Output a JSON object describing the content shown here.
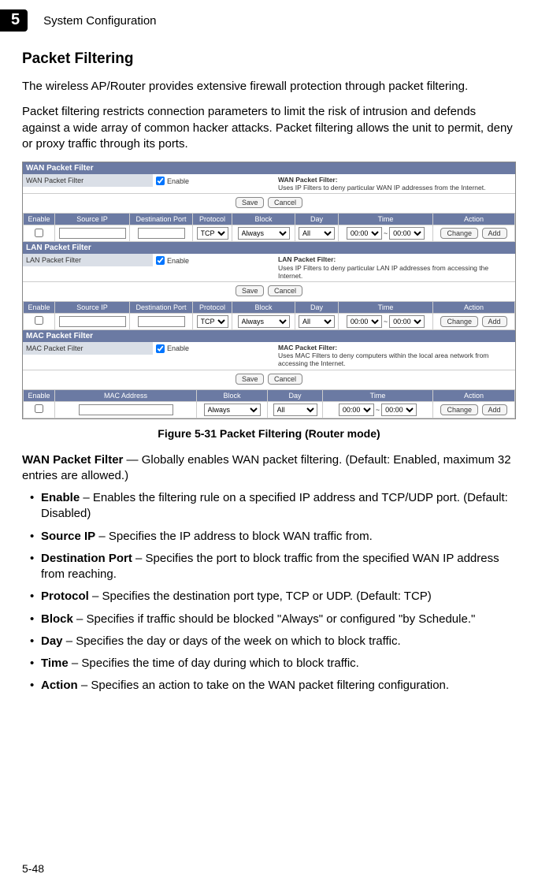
{
  "header": {
    "chapter_num": "5",
    "chapter_title": "System Configuration"
  },
  "section": {
    "title": "Packet Filtering",
    "p1": "The wireless AP/Router provides extensive firewall protection through packet filtering.",
    "p2": "Packet filtering restricts connection parameters to limit the risk of intrusion and defends against a wide array of common hacker attacks. Packet filtering allows the unit to permit, deny or proxy traffic through its ports."
  },
  "screenshot": {
    "enable_label": "Enable",
    "save_btn": "Save",
    "cancel_btn": "Cancel",
    "change_btn": "Change",
    "add_btn": "Add",
    "sections": {
      "wan": {
        "hdr": "WAN Packet Filter",
        "row_label": "WAN Packet Filter",
        "desc_title": "WAN Packet Filter:",
        "desc_body": "Uses IP Filters to deny particular WAN IP addresses from the Internet."
      },
      "lan": {
        "hdr": "LAN Packet Filter",
        "row_label": "LAN Packet Filter",
        "desc_title": "LAN Packet Filter:",
        "desc_body": "Uses IP Filters to deny particular LAN IP addresses from accessing the Internet."
      },
      "mac": {
        "hdr": "MAC Packet Filter",
        "row_label": "MAC Packet Filter",
        "desc_title": "MAC Packet Filter:",
        "desc_body": "Uses MAC Filters to deny computers within the local area network from accessing the Internet."
      }
    },
    "ip_table": {
      "cols": [
        "Enable",
        "Source IP",
        "Destination Port",
        "Protocol",
        "Block",
        "Day",
        "Time",
        "Action"
      ],
      "protocol": "TCP",
      "block": "Always",
      "day": "All",
      "t1": "00:00",
      "t2": "00:00"
    },
    "mac_table": {
      "cols": [
        "Enable",
        "MAC Address",
        "Block",
        "Day",
        "Time",
        "Action"
      ],
      "block": "Always",
      "day": "All",
      "t1": "00:00",
      "t2": "00:00"
    }
  },
  "figure_caption": "Figure 5-31  Packet Filtering (Router mode)",
  "desc": {
    "lead_bold": "WAN Packet Filter",
    "lead_rest": " — Globally enables WAN packet filtering. (Default: Enabled, maximum 32 entries are allowed.)",
    "items": [
      {
        "b": "Enable",
        "t": " – Enables the filtering rule on a specified IP address and TCP/UDP port. (Default: Disabled)"
      },
      {
        "b": "Source IP",
        "t": " – Specifies the IP address to block WAN traffic from."
      },
      {
        "b": "Destination Port",
        "t": " – Specifies the port to block traffic from the specified WAN IP address from reaching."
      },
      {
        "b": "Protocol",
        "t": " – Specifies the destination port type, TCP or UDP. (Default: TCP)"
      },
      {
        "b": "Block",
        "t": " – Specifies if traffic should be blocked \"Always\" or configured \"by Schedule.\""
      },
      {
        "b": "Day",
        "t": " – Specifies the day or days of the week on which to block traffic."
      },
      {
        "b": "Time",
        "t": " – Specifies the time of day during which to block traffic."
      },
      {
        "b": "Action",
        "t": " – Specifies an action to take on the WAN packet filtering configuration."
      }
    ]
  },
  "footer": {
    "page": "5-48"
  }
}
